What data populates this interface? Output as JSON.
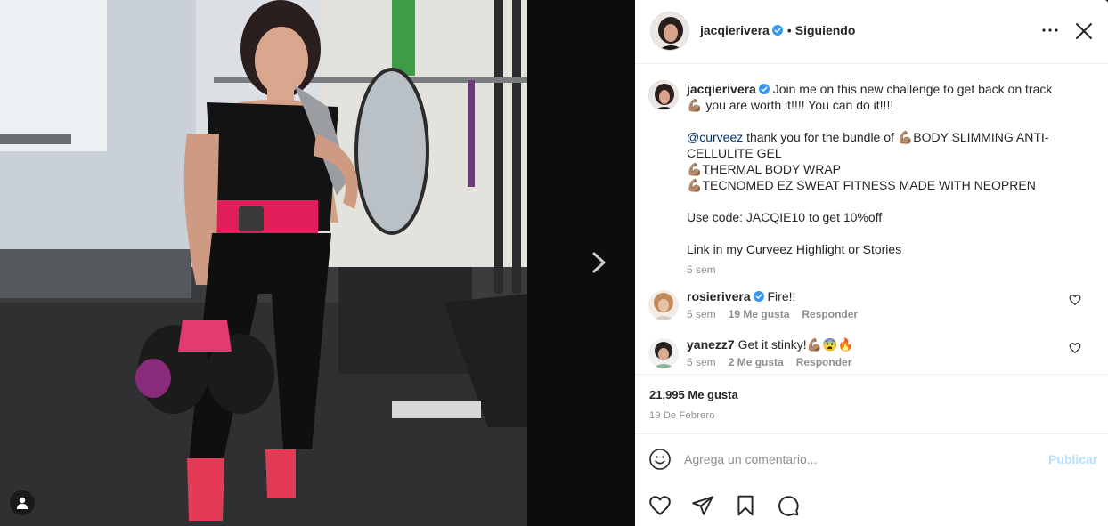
{
  "post_header": {
    "username": "jacqierivera",
    "separator": "•",
    "follow_status": "Siguiendo"
  },
  "caption": {
    "username": "jacqierivera",
    "line1": "Join me on this new challenge to get back on track",
    "line2": "you are worth it!!!! You can do it!!!!",
    "mention": "@curveez",
    "mention_text": " thank you for the bundle of ",
    "product1": "BODY SLIMMING ANTI-CELLULITE GEL",
    "product2": "THERMAL BODY WRAP",
    "product3": "TECNOMED EZ SWEAT FITNESS MADE WITH NEOPREN",
    "code_line": "Use code: JACQIE10 to get 10%off",
    "link_line": "Link in my Curveez Highlight or Stories",
    "time": "5 sem"
  },
  "comments": [
    {
      "username": "rosierivera",
      "text": "Fire!!",
      "time": "5 sem",
      "likes": "19 Me gusta",
      "reply": "Responder"
    },
    {
      "username": "yanezz7",
      "text": "Get it stinky!",
      "time": "5 sem",
      "likes": "2 Me gusta",
      "reply": "Responder"
    }
  ],
  "stats": {
    "likes": "21,995 Me gusta",
    "date": "19 De Febrero"
  },
  "add_comment": {
    "placeholder": "Agrega un comentario...",
    "post_label": "Publicar"
  },
  "icons": {
    "verified": "verified-badge-icon",
    "more": "more-options-icon",
    "close": "close-icon",
    "next": "chevron-right-icon",
    "emoji": "emoji-icon",
    "like": "heart-icon",
    "share": "paper-plane-icon",
    "save": "bookmark-icon",
    "comment": "comment-bubble-icon",
    "user_tag": "user-tag-icon"
  },
  "colors": {
    "accent": "#0095f6",
    "verified": "#3897f0",
    "mention": "#00376b",
    "muted": "#8e8e8e",
    "text": "#262626"
  }
}
